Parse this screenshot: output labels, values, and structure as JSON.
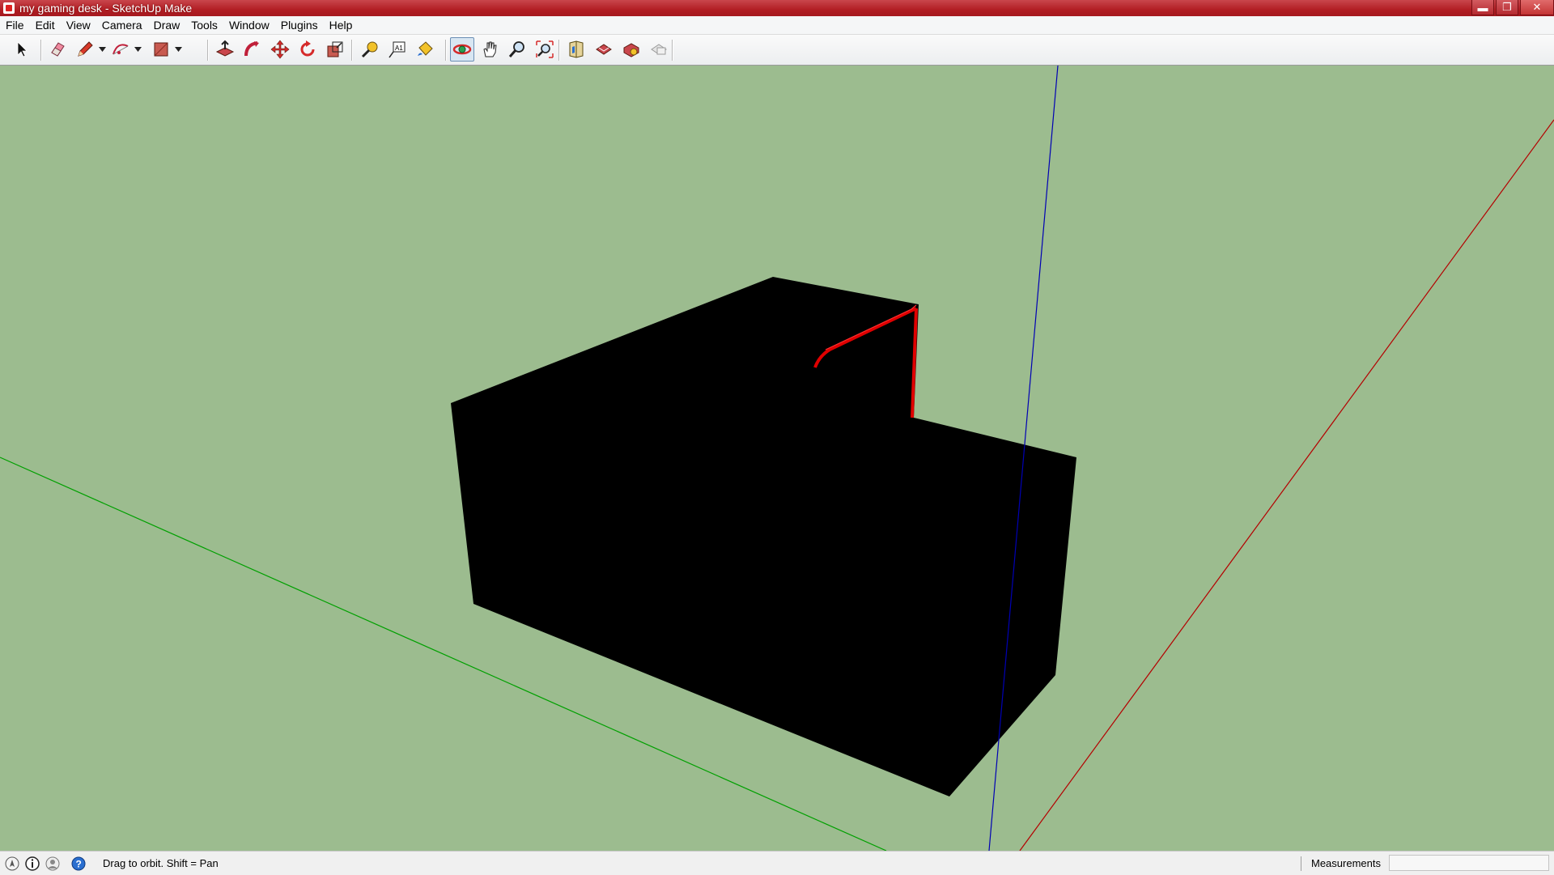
{
  "window": {
    "title": "my gaming desk - SketchUp Make",
    "controls": {
      "minimize": "▬",
      "maximize": "❐",
      "close": "✕"
    }
  },
  "menu": [
    "File",
    "Edit",
    "View",
    "Camera",
    "Draw",
    "Tools",
    "Window",
    "Plugins",
    "Help"
  ],
  "toolbar": {
    "active_tool": "orbit",
    "tools": [
      "select",
      "eraser",
      "pencil",
      "arc",
      "rectangle",
      "push-pull",
      "follow-me",
      "move",
      "rotate",
      "scale",
      "tape-measure",
      "text",
      "paint-bucket",
      "orbit",
      "pan",
      "zoom",
      "zoom-extents",
      "get-models",
      "share-model",
      "extension-warehouse",
      "share-component"
    ]
  },
  "colors": {
    "viewport_bg": "#9cbc8f",
    "model_fill": "#000000",
    "selection_edge": "#e00000",
    "axis_red": "#b40000",
    "axis_green": "#00a000",
    "axis_blue": "#0000b4"
  },
  "status": {
    "hint": "Drag to orbit.  Shift = Pan",
    "measurements_label": "Measurements",
    "measurements_value": ""
  }
}
